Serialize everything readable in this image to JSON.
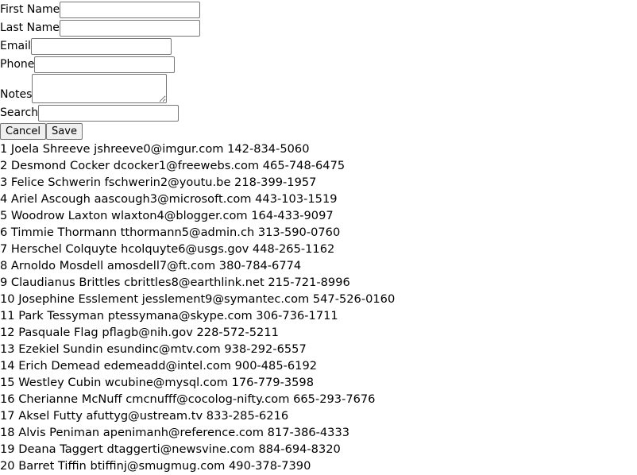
{
  "form": {
    "first_name_label": "First Name",
    "first_name_value": "",
    "last_name_label": "Last Name",
    "last_name_value": "",
    "email_label": "Email",
    "email_value": "",
    "phone_label": "Phone",
    "phone_value": "",
    "notes_label": "Notes",
    "notes_value": "",
    "search_label": "Search",
    "search_value": "",
    "cancel_label": "Cancel",
    "save_label": "Save"
  },
  "contacts": [
    "1 Joela Shreeve jshreeve0@imgur.com 142-834-5060",
    "2 Desmond Cocker dcocker1@freewebs.com 465-748-6475",
    "3 Felice Schwerin fschwerin2@youtu.be 218-399-1957",
    "4 Ariel Ascough aascough3@microsoft.com 443-103-1519",
    "5 Woodrow Laxton wlaxton4@blogger.com 164-433-9097",
    "6 Timmie Thormann tthormann5@admin.ch 313-590-0760",
    "7 Herschel Colquyte hcolquyte6@usgs.gov 448-265-1162",
    "8 Arnoldo Mosdell amosdell7@ft.com 380-784-6774",
    "9 Claudianus Brittles cbrittles8@earthlink.net 215-721-8996",
    "10 Josephine Esslement jesslement9@symantec.com 547-526-0160",
    "11 Park Tessyman ptessymana@skype.com 306-736-1711",
    "12 Pasquale Flag pflagb@nih.gov 228-572-5211",
    "13 Ezekiel Sundin esundinc@mtv.com 938-292-6557",
    "14 Erich Demead edemeadd@intel.com 900-485-6192",
    "15 Westley Cubin wcubine@mysql.com 176-779-3598",
    "16 Cherianne McNuff cmcnufff@cocolog-nifty.com 665-293-7676",
    "17 Aksel Futty afuttyg@ustream.tv 833-285-6216",
    "18 Alvis Peniman apenimanh@reference.com 817-386-4333",
    "19 Deana Taggert dtaggerti@newsvine.com 884-694-8320",
    "20 Barret Tiffin btiffinj@smugmug.com 490-378-7390"
  ]
}
